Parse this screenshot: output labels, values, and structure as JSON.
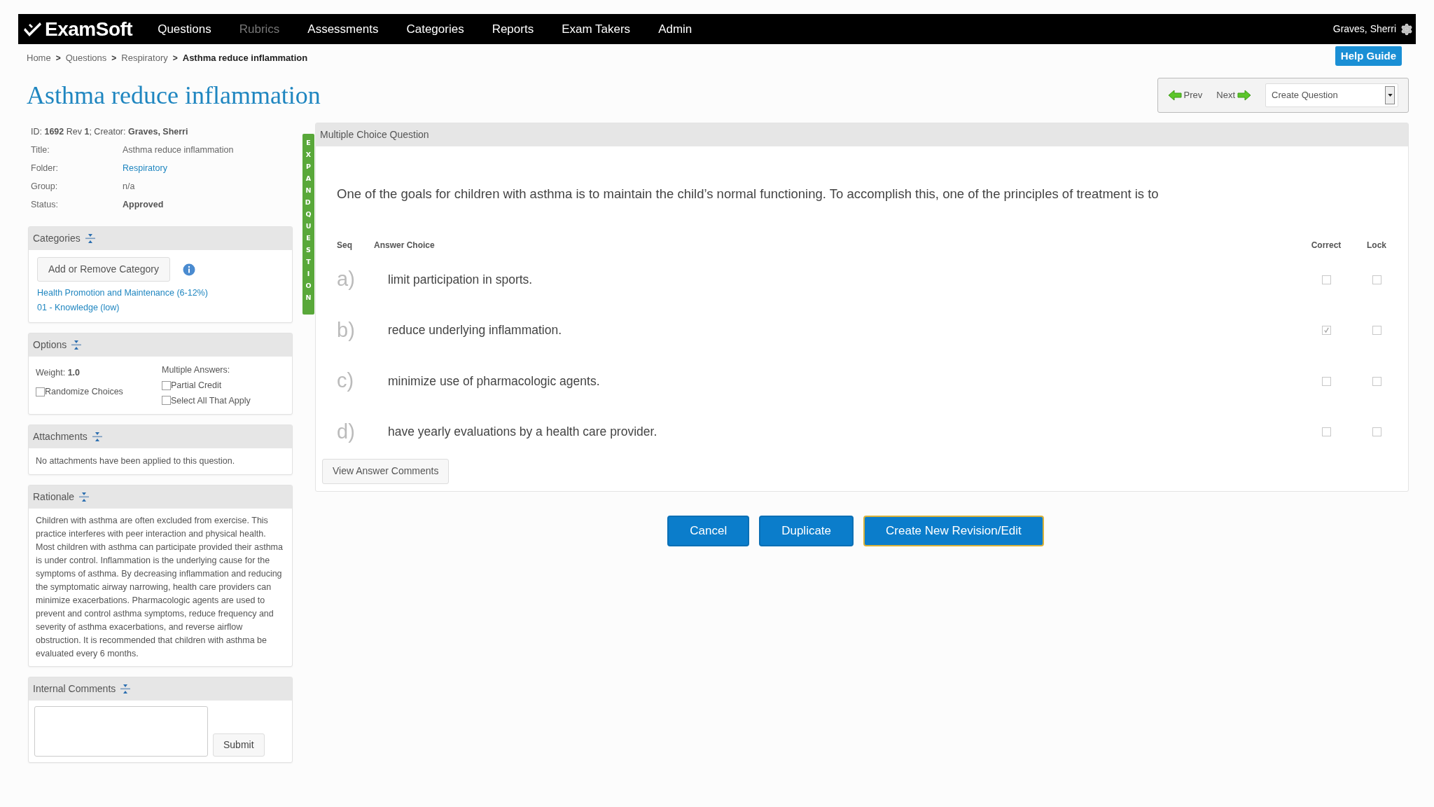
{
  "nav": {
    "logo": "ExamSoft",
    "items": [
      {
        "label": "Questions",
        "disabled": false
      },
      {
        "label": "Rubrics",
        "disabled": true
      },
      {
        "label": "Assessments",
        "disabled": false
      },
      {
        "label": "Categories",
        "disabled": false
      },
      {
        "label": "Reports",
        "disabled": false
      },
      {
        "label": "Exam Takers",
        "disabled": false
      },
      {
        "label": "Admin",
        "disabled": false
      }
    ],
    "user": "Graves, Sherri"
  },
  "breadcrumb_separator": ">",
  "breadcrumb": [
    {
      "label": "Home",
      "current": false
    },
    {
      "label": "Questions",
      "current": false
    },
    {
      "label": "Respiratory",
      "current": false
    },
    {
      "label": "Asthma reduce inflammation",
      "current": true
    }
  ],
  "help_button": "Help Guide",
  "page_title": "Asthma reduce inflammation",
  "pager": {
    "prev": "Prev",
    "next": "Next",
    "select": "Create Question"
  },
  "details": {
    "id_line": "ID: **1692** Rev **1**; Creator: **Graves, Sherri**",
    "fields": [
      {
        "label": "Title:",
        "value": "Asthma reduce inflammation",
        "kind": "text"
      },
      {
        "label": "Folder:",
        "value": "Respiratory",
        "kind": "link"
      },
      {
        "label": "Group:",
        "value": "n/a",
        "kind": "text"
      },
      {
        "label": "Status:",
        "value": "Approved",
        "kind": "bold"
      }
    ]
  },
  "categories": {
    "title": "Categories",
    "button": "Add or Remove Category",
    "items": [
      "Health Promotion and Maintenance (6-12%)",
      "01 - Knowledge (low)"
    ]
  },
  "options": {
    "title": "Options",
    "weight": "Weight: **1.0**",
    "randomize": {
      "label": "Randomize Choices",
      "checked": false
    },
    "multiple_label": "Multiple Answers:",
    "multiple": [
      {
        "label": "Partial Credit",
        "checked": false
      },
      {
        "label": "Select All That Apply",
        "checked": false
      }
    ]
  },
  "attachments": {
    "title": "Attachments",
    "text": "No attachments have been applied to this question."
  },
  "rationale": {
    "title": "Rationale",
    "text": "Children with asthma are often excluded from exercise. This practice interferes with peer interaction and physical health. Most children with asthma can participate provided their asthma is under control. Inflammation is the underlying cause for the symptoms of asthma. By decreasing inflammation and reducing the symptomatic airway narrowing, health care providers can minimize exacerbations. Pharmacologic agents are used to prevent and control asthma symptoms, reduce frequency and severity of asthma exacerbations, and reverse airflow obstruction. It is recommended that children with asthma be evaluated every 6 months."
  },
  "internal_comments": {
    "title": "Internal Comments",
    "button": "Submit"
  },
  "expand_tab": "EXPAND QUESTION",
  "question": {
    "header": "Multiple Choice Question",
    "stem": "One of the goals for children with asthma is to maintain the child’s normal functioning. To accomplish this, one of the principles of treatment is to",
    "columns": {
      "seq": "Seq",
      "choice": "Answer Choice",
      "correct": "Correct",
      "lock": "Lock"
    },
    "choices": [
      {
        "seq": "a)",
        "text": "limit participation in sports.",
        "correct": false,
        "locked": false
      },
      {
        "seq": "b)",
        "text": "reduce underlying inflammation.",
        "correct": true,
        "locked": false
      },
      {
        "seq": "c)",
        "text": "minimize use of pharmacologic agents.",
        "correct": false,
        "locked": false
      },
      {
        "seq": "d)",
        "text": "have yearly evaluations by a health care provider.",
        "correct": false,
        "locked": false
      }
    ],
    "comments_button": "View Answer Comments"
  },
  "actions": [
    {
      "label": "Cancel",
      "focused": false
    },
    {
      "label": "Duplicate",
      "focused": false
    },
    {
      "label": "Create New Revision/Edit",
      "focused": true
    }
  ]
}
